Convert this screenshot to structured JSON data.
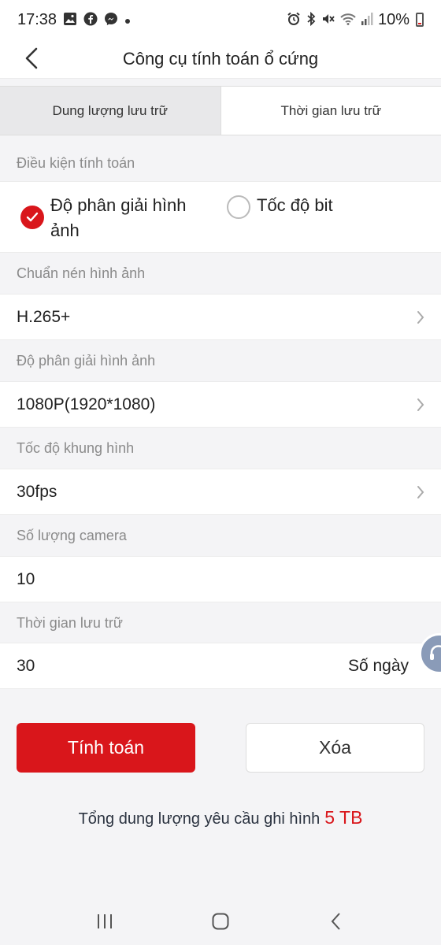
{
  "status_bar": {
    "time": "17:38",
    "battery_text": "10%",
    "left_icons": [
      "gallery-icon",
      "facebook-icon",
      "messenger-icon",
      "dot-icon"
    ],
    "right_icons": [
      "alarm-icon",
      "bluetooth-icon",
      "mute-icon",
      "wifi-icon",
      "signal-icon",
      "battery-icon"
    ]
  },
  "header": {
    "title": "Công cụ tính toán ổ cứng"
  },
  "tabs": [
    {
      "label": "Dung lượng lưu trữ",
      "active": true
    },
    {
      "label": "Thời gian lưu trữ",
      "active": false
    }
  ],
  "calc_condition": {
    "label": "Điều kiện tính toán",
    "options": [
      {
        "label": "Độ phân giải hình ảnh",
        "checked": true
      },
      {
        "label": "Tốc độ bit",
        "checked": false
      }
    ]
  },
  "fields": {
    "compression": {
      "label": "Chuẩn nén hình ảnh",
      "value": "H.265+"
    },
    "resolution": {
      "label": "Độ phân giải hình ảnh",
      "value": "1080P(1920*1080)"
    },
    "frame_rate": {
      "label": "Tốc độ khung hình",
      "value": "30fps"
    },
    "camera_count": {
      "label": "Số lượng camera",
      "value": "10"
    },
    "storage_time": {
      "label": "Thời gian lưu trữ",
      "value": "30",
      "unit": "Số ngày"
    }
  },
  "buttons": {
    "calculate": "Tính toán",
    "clear": "Xóa"
  },
  "result": {
    "label": "Tổng dung lượng yêu cầu ghi hình",
    "value": "5 TB"
  },
  "colors": {
    "accent": "#d9161b",
    "background": "#f4f4f6"
  }
}
